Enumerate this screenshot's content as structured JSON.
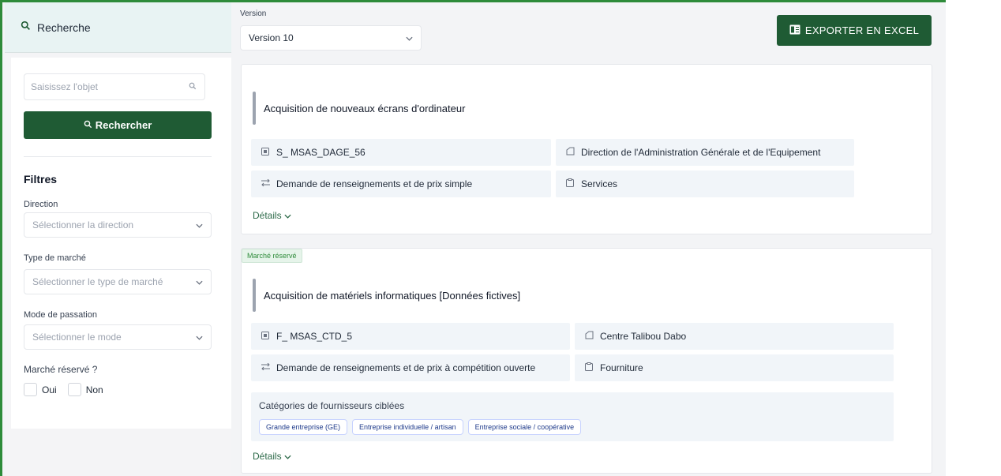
{
  "sidebar": {
    "search_header": "Recherche",
    "search_placeholder": "Saisissez l'objet",
    "search_button": "Rechercher",
    "filters_title": "Filtres",
    "filters": [
      {
        "label": "Direction",
        "placeholder": "Sélectionner la direction"
      },
      {
        "label": "Type de marché",
        "placeholder": "Sélectionner le type de marché"
      },
      {
        "label": "Mode de passation",
        "placeholder": "Sélectionner le mode"
      }
    ],
    "reserved_label": "Marché réservé ?",
    "reserved_options": [
      "Oui",
      "Non"
    ]
  },
  "main": {
    "version_label": "Version",
    "version_value": "Version 10",
    "export_button": "EXPORTER EN EXCEL",
    "cards": [
      {
        "badge": "",
        "title": "Acquisition de nouveaux écrans d'ordinateur",
        "reference": "S_ MSAS_DAGE_56",
        "direction": "Direction de l'Administration Générale et de l'Equipement",
        "mode": "Demande de renseignements et de prix simple",
        "type": "Services",
        "details": "Détails"
      },
      {
        "badge": "Marché réservé",
        "title": "Acquisition de matériels informatiques [Données fictives]",
        "reference": "F_ MSAS_CTD_5",
        "direction": "Centre Talibou Dabo",
        "mode": "Demande de renseignements et de prix à compétition ouverte",
        "type": "Fourniture",
        "categories_title": "Catégories de fournisseurs ciblées",
        "categories": [
          "Grande entreprise (GE)",
          "Entreprise individuelle / artisan",
          "Entreprise sociale / coopérative"
        ],
        "details": "Détails"
      }
    ]
  },
  "colors": {
    "primary": "#1f5b34",
    "accent_border": "#2e8b3a"
  },
  "icons": [
    "search-icon",
    "chevron-down-icon",
    "excel-icon",
    "reference-icon",
    "building-icon",
    "transfer-icon",
    "clipboard-icon"
  ]
}
